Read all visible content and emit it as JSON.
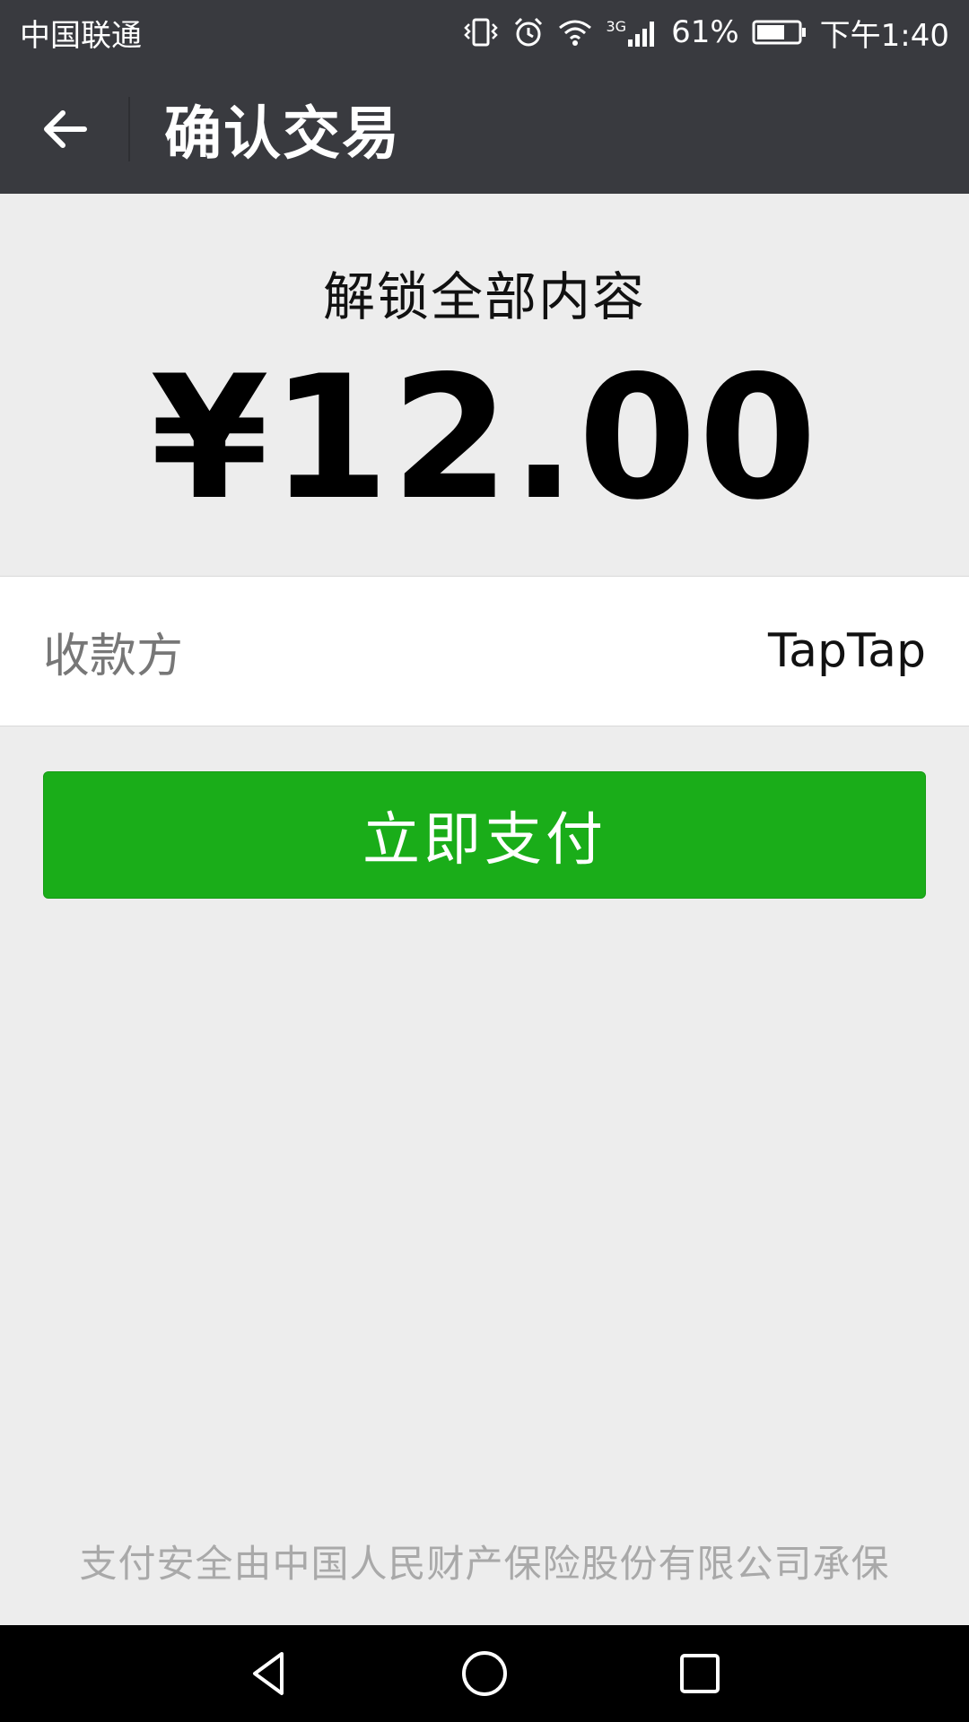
{
  "status_bar": {
    "carrier": "中国联通",
    "network": "3G",
    "battery": "61%",
    "time": "下午1:40",
    "icons": [
      "vibrate-icon",
      "alarm-icon",
      "wifi-icon",
      "signal-icon",
      "battery-icon"
    ]
  },
  "header": {
    "title": "确认交易",
    "back_icon": "arrow-left-icon"
  },
  "summary": {
    "item_name": "解锁全部内容",
    "amount": "¥12.00"
  },
  "payee": {
    "label": "收款方",
    "value": "TapTap"
  },
  "actions": {
    "pay_label": "立即支付"
  },
  "footer": {
    "note": "支付安全由中国人民财产保险股份有限公司承保"
  },
  "navigation": {
    "icons": [
      "back-triangle-icon",
      "home-circle-icon",
      "recents-square-icon"
    ]
  },
  "colors": {
    "header_bg": "#393a3f",
    "page_bg": "#ededed",
    "accent_green": "#1aad19"
  }
}
